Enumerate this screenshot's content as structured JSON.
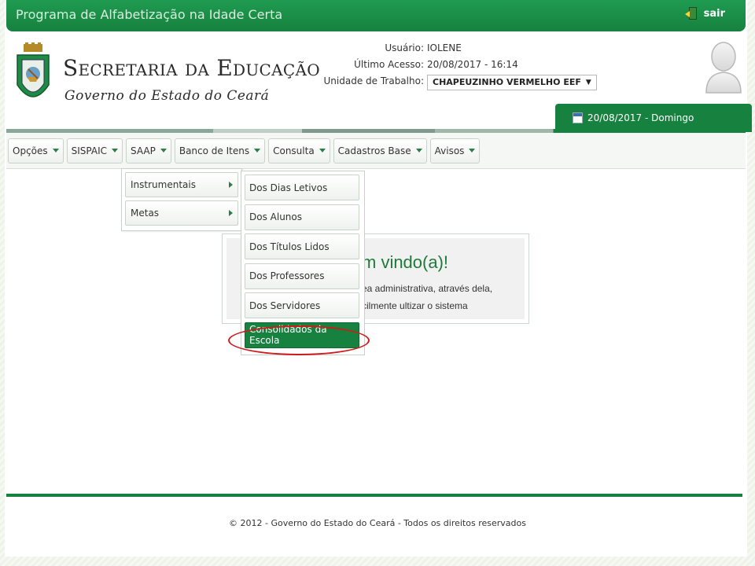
{
  "topbar": {
    "title": "Programa de Alfabetização na Idade Certa",
    "logout_label": "sair",
    "logout_icon": "exit-door-icon"
  },
  "header": {
    "brand_title": "Secretaria da Educação",
    "brand_subtitle": "Governo do Estado do Ceará",
    "crest_icon": "ceara-coat-of-arms-icon",
    "avatar_icon": "user-avatar-icon",
    "user": {
      "user_label": "Usuário:",
      "user_value": "IOLENE",
      "last_access_label": "Último Acesso:",
      "last_access_value": "20/08/2017 - 16:14",
      "unit_label": "Unidade de Trabalho:",
      "unit_value": "CHAPEUZINHO VERMELHO EEF"
    },
    "date_tab": "20/08/2017 - Domingo",
    "date_icon": "calendar-icon"
  },
  "menu": {
    "items": [
      {
        "label": "Opções"
      },
      {
        "label": "SISPAIC"
      },
      {
        "label": "SAAP"
      },
      {
        "label": "Banco de Itens"
      },
      {
        "label": "Consulta"
      },
      {
        "label": "Cadastros Base"
      },
      {
        "label": "Avisos"
      }
    ],
    "saap_submenu": [
      {
        "label": "Instrumentais"
      },
      {
        "label": "Metas"
      }
    ],
    "instrumentais_submenu": [
      {
        "label": "Dos Dias Letivos"
      },
      {
        "label": "Dos Alunos"
      },
      {
        "label": "Dos Títulos Lidos"
      },
      {
        "label": "Dos Professores"
      },
      {
        "label": "Dos Servidores"
      },
      {
        "label": "Consolidados da Escola",
        "active": true
      }
    ]
  },
  "welcome": {
    "title": "m vindo(a)!",
    "line1": "ea administrativa, através dela,",
    "line2": "cilmente ultizar o sistema"
  },
  "footer": {
    "copyright": "© 2012 - Governo do Estado do Ceará - Todos os direitos reservados"
  },
  "colors": {
    "brand_green": "#17813f",
    "highlight_red": "#d01919"
  }
}
